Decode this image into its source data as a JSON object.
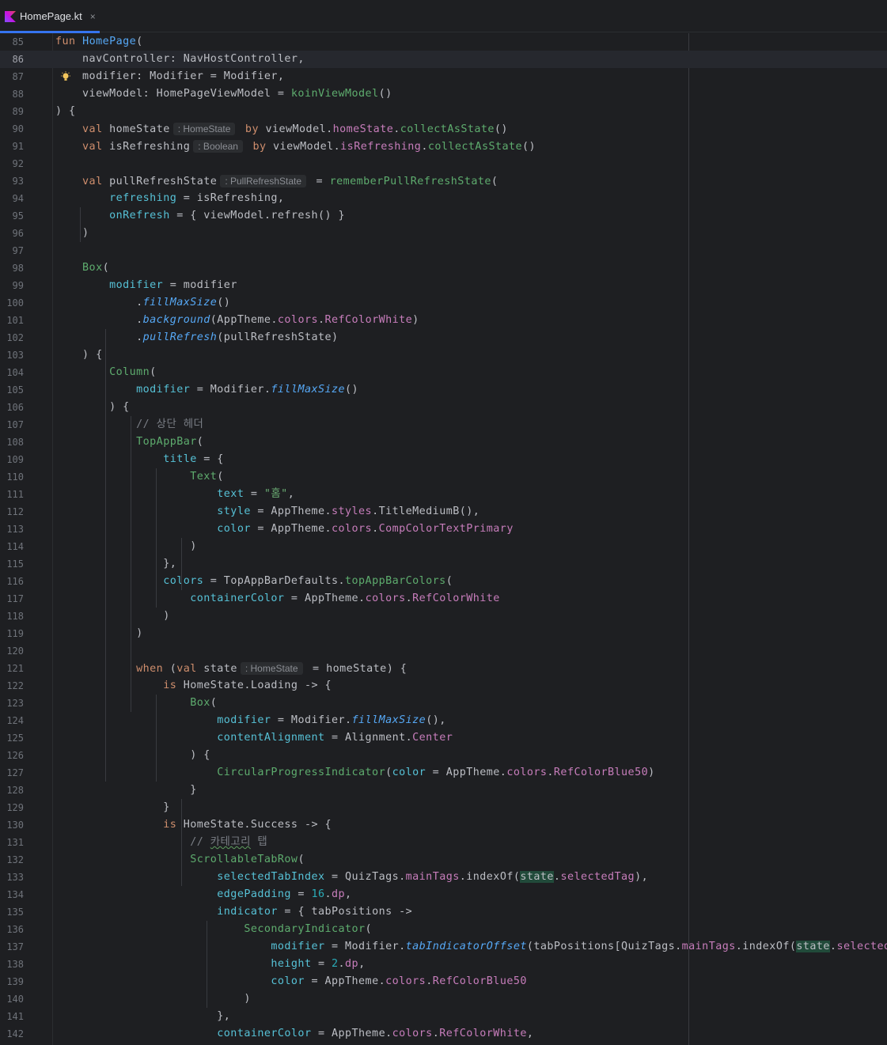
{
  "tab": {
    "filename": "HomePage.kt",
    "close": "×"
  },
  "editor": {
    "current_line": 86,
    "lines": [
      {
        "n": 85,
        "tokens": [
          [
            "kw",
            "fun "
          ],
          [
            "fn",
            "HomePage"
          ],
          [
            "",
            "("
          ]
        ]
      },
      {
        "n": 86,
        "tokens": [
          [
            "",
            "    navController: NavHostController,"
          ]
        ]
      },
      {
        "n": 87,
        "tokens": [
          [
            "",
            "    modifier: Modifier = Modifier,"
          ]
        ]
      },
      {
        "n": 88,
        "tokens": [
          [
            "",
            "    viewModel: HomePageViewModel = "
          ],
          [
            "comp",
            "koinViewModel"
          ],
          [
            "",
            "()"
          ]
        ]
      },
      {
        "n": 89,
        "tokens": [
          [
            "",
            ") {"
          ]
        ]
      },
      {
        "n": 90,
        "tokens": [
          [
            "kw",
            "    val "
          ],
          [
            "",
            "homeState"
          ],
          [
            "hint",
            ": HomeState"
          ],
          [
            "kw",
            " by "
          ],
          [
            "",
            "viewModel."
          ],
          [
            "pr",
            "homeState"
          ],
          [
            "",
            "."
          ],
          [
            "comp",
            "collectAsState"
          ],
          [
            "",
            "()"
          ]
        ]
      },
      {
        "n": 91,
        "tokens": [
          [
            "kw",
            "    val "
          ],
          [
            "",
            "isRefreshing"
          ],
          [
            "hint",
            ": Boolean"
          ],
          [
            "kw",
            " by "
          ],
          [
            "",
            "viewModel."
          ],
          [
            "pr",
            "isRefreshing"
          ],
          [
            "",
            "."
          ],
          [
            "comp",
            "collectAsState"
          ],
          [
            "",
            "()"
          ]
        ]
      },
      {
        "n": 92,
        "tokens": []
      },
      {
        "n": 93,
        "tokens": [
          [
            "kw",
            "    val "
          ],
          [
            "",
            "pullRefreshState"
          ],
          [
            "hint",
            ": PullRefreshState"
          ],
          [
            "",
            ""
          ],
          [
            "",
            " = "
          ],
          [
            "comp",
            "rememberPullRefreshState"
          ],
          [
            "",
            "("
          ]
        ]
      },
      {
        "n": 94,
        "tokens": [
          [
            "pm",
            "        refreshing"
          ],
          [
            "",
            " = isRefreshing,"
          ]
        ]
      },
      {
        "n": 95,
        "tokens": [
          [
            "pm",
            "        onRefresh"
          ],
          [
            "",
            " = { viewModel.refresh() }"
          ]
        ]
      },
      {
        "n": 96,
        "tokens": [
          [
            "",
            "    )"
          ]
        ]
      },
      {
        "n": 97,
        "tokens": []
      },
      {
        "n": 98,
        "tokens": [
          [
            "comp",
            "    Box"
          ],
          [
            "",
            "("
          ]
        ]
      },
      {
        "n": 99,
        "tokens": [
          [
            "pm",
            "        modifier"
          ],
          [
            "",
            " = modifier"
          ]
        ]
      },
      {
        "n": 100,
        "tokens": [
          [
            "",
            "            ."
          ],
          [
            "ext",
            "fillMaxSize"
          ],
          [
            "",
            "()"
          ]
        ]
      },
      {
        "n": 101,
        "tokens": [
          [
            "",
            "            ."
          ],
          [
            "ext",
            "background"
          ],
          [
            "",
            "(AppTheme."
          ],
          [
            "pr",
            "colors"
          ],
          [
            "",
            "."
          ],
          [
            "pr",
            "RefColorWhite"
          ],
          [
            "",
            ")"
          ]
        ]
      },
      {
        "n": 102,
        "tokens": [
          [
            "",
            "            ."
          ],
          [
            "ext",
            "pullRefresh"
          ],
          [
            "",
            "(pullRefreshState)"
          ]
        ]
      },
      {
        "n": 103,
        "tokens": [
          [
            "",
            "    ) {"
          ]
        ]
      },
      {
        "n": 104,
        "tokens": [
          [
            "comp",
            "        Column"
          ],
          [
            "",
            "("
          ]
        ]
      },
      {
        "n": 105,
        "tokens": [
          [
            "pm",
            "            modifier"
          ],
          [
            "",
            " = Modifier."
          ],
          [
            "ext",
            "fillMaxSize"
          ],
          [
            "",
            "()"
          ]
        ]
      },
      {
        "n": 106,
        "tokens": [
          [
            "",
            "        ) {"
          ]
        ]
      },
      {
        "n": 107,
        "tokens": [
          [
            "cm",
            "            // 상단 헤더"
          ]
        ]
      },
      {
        "n": 108,
        "tokens": [
          [
            "comp",
            "            TopAppBar"
          ],
          [
            "",
            "("
          ]
        ]
      },
      {
        "n": 109,
        "tokens": [
          [
            "pm",
            "                title"
          ],
          [
            "",
            " = {"
          ]
        ]
      },
      {
        "n": 110,
        "tokens": [
          [
            "comp",
            "                    Text"
          ],
          [
            "",
            "("
          ]
        ]
      },
      {
        "n": 111,
        "tokens": [
          [
            "pm",
            "                        text"
          ],
          [
            "",
            " = "
          ],
          [
            "str",
            "\"홈\""
          ],
          [
            "",
            ","
          ]
        ]
      },
      {
        "n": 112,
        "tokens": [
          [
            "pm",
            "                        style"
          ],
          [
            "",
            " = AppTheme."
          ],
          [
            "pr",
            "styles"
          ],
          [
            "",
            ".TitleMediumB(),"
          ]
        ]
      },
      {
        "n": 113,
        "tokens": [
          [
            "pm",
            "                        color"
          ],
          [
            "",
            " = AppTheme."
          ],
          [
            "pr",
            "colors"
          ],
          [
            "",
            "."
          ],
          [
            "pr",
            "CompColorTextPrimary"
          ]
        ]
      },
      {
        "n": 114,
        "tokens": [
          [
            "",
            "                    )"
          ]
        ]
      },
      {
        "n": 115,
        "tokens": [
          [
            "",
            "                },"
          ]
        ]
      },
      {
        "n": 116,
        "tokens": [
          [
            "pm",
            "                colors"
          ],
          [
            "",
            " = TopAppBarDefaults."
          ],
          [
            "comp",
            "topAppBarColors"
          ],
          [
            "",
            "("
          ]
        ]
      },
      {
        "n": 117,
        "tokens": [
          [
            "pm",
            "                    containerColor"
          ],
          [
            "",
            " = AppTheme."
          ],
          [
            "pr",
            "colors"
          ],
          [
            "",
            "."
          ],
          [
            "pr",
            "RefColorWhite"
          ]
        ]
      },
      {
        "n": 118,
        "tokens": [
          [
            "",
            "                )"
          ]
        ]
      },
      {
        "n": 119,
        "tokens": [
          [
            "",
            "            )"
          ]
        ]
      },
      {
        "n": 120,
        "tokens": []
      },
      {
        "n": 121,
        "tokens": [
          [
            "kw",
            "            when "
          ],
          [
            "",
            "("
          ],
          [
            "kw",
            "val "
          ],
          [
            "",
            "state"
          ],
          [
            "hint",
            ": HomeState"
          ],
          [
            "",
            " = homeState) {"
          ]
        ]
      },
      {
        "n": 122,
        "tokens": [
          [
            "kw",
            "                is "
          ],
          [
            "",
            "HomeState.Loading -> {"
          ]
        ]
      },
      {
        "n": 123,
        "tokens": [
          [
            "comp",
            "                    Box"
          ],
          [
            "",
            "("
          ]
        ]
      },
      {
        "n": 124,
        "tokens": [
          [
            "pm",
            "                        modifier"
          ],
          [
            "",
            " = Modifier."
          ],
          [
            "ext",
            "fillMaxSize"
          ],
          [
            "",
            "(),"
          ]
        ]
      },
      {
        "n": 125,
        "tokens": [
          [
            "pm",
            "                        contentAlignment"
          ],
          [
            "",
            " = Alignment."
          ],
          [
            "pr",
            "Center"
          ]
        ]
      },
      {
        "n": 126,
        "tokens": [
          [
            "",
            "                    ) {"
          ]
        ]
      },
      {
        "n": 127,
        "tokens": [
          [
            "comp",
            "                        CircularProgressIndicator"
          ],
          [
            "",
            "("
          ],
          [
            "pm",
            "color"
          ],
          [
            "",
            " = AppTheme."
          ],
          [
            "pr",
            "colors"
          ],
          [
            "",
            "."
          ],
          [
            "pr",
            "RefColorBlue50"
          ],
          [
            "",
            ")"
          ]
        ]
      },
      {
        "n": 128,
        "tokens": [
          [
            "",
            "                    }"
          ]
        ]
      },
      {
        "n": 129,
        "tokens": [
          [
            "",
            "                }"
          ]
        ]
      },
      {
        "n": 130,
        "tokens": [
          [
            "kw",
            "                is "
          ],
          [
            "",
            "HomeState.Success -> {"
          ]
        ]
      },
      {
        "n": 131,
        "tokens": [
          [
            "cm",
            "                    // "
          ],
          [
            "cm typo",
            "카테고리"
          ],
          [
            "cm",
            " 탭"
          ]
        ]
      },
      {
        "n": 132,
        "tokens": [
          [
            "comp",
            "                    ScrollableTabRow"
          ],
          [
            "",
            "("
          ]
        ]
      },
      {
        "n": 133,
        "tokens": [
          [
            "pm",
            "                        selectedTabIndex"
          ],
          [
            "",
            " = QuizTags."
          ],
          [
            "pr",
            "mainTags"
          ],
          [
            "",
            ".indexOf("
          ],
          [
            "hl",
            "state"
          ],
          [
            "",
            "."
          ],
          [
            "pr",
            "selectedTag"
          ],
          [
            "",
            "),"
          ]
        ]
      },
      {
        "n": 134,
        "tokens": [
          [
            "pm",
            "                        edgePadding"
          ],
          [
            "",
            " = "
          ],
          [
            "num",
            "16"
          ],
          [
            "",
            "."
          ],
          [
            "pr",
            "dp"
          ],
          [
            "",
            ","
          ]
        ]
      },
      {
        "n": 135,
        "tokens": [
          [
            "pm",
            "                        indicator"
          ],
          [
            "",
            " = { tabPositions ->"
          ]
        ]
      },
      {
        "n": 136,
        "tokens": [
          [
            "comp",
            "                            SecondaryIndicator"
          ],
          [
            "",
            "("
          ]
        ]
      },
      {
        "n": 137,
        "tokens": [
          [
            "pm",
            "                                modifier"
          ],
          [
            "",
            " = Modifier."
          ],
          [
            "ext",
            "tabIndicatorOffset"
          ],
          [
            "",
            "(tabPositions[QuizTags."
          ],
          [
            "pr",
            "mainTags"
          ],
          [
            "",
            ".indexOf("
          ],
          [
            "hl",
            "state"
          ],
          [
            "",
            "."
          ],
          [
            "pr",
            "selectedTag"
          ],
          [
            "",
            ")]),"
          ]
        ]
      },
      {
        "n": 138,
        "tokens": [
          [
            "pm",
            "                                height"
          ],
          [
            "",
            " = "
          ],
          [
            "num",
            "2"
          ],
          [
            "",
            "."
          ],
          [
            "pr",
            "dp"
          ],
          [
            "",
            ","
          ]
        ]
      },
      {
        "n": 139,
        "tokens": [
          [
            "pm",
            "                                color"
          ],
          [
            "",
            " = AppTheme."
          ],
          [
            "pr",
            "colors"
          ],
          [
            "",
            "."
          ],
          [
            "pr",
            "RefColorBlue50"
          ]
        ]
      },
      {
        "n": 140,
        "tokens": [
          [
            "",
            "                            )"
          ]
        ]
      },
      {
        "n": 141,
        "tokens": [
          [
            "",
            "                        },"
          ]
        ]
      },
      {
        "n": 142,
        "tokens": [
          [
            "pm",
            "                        containerColor"
          ],
          [
            "",
            " = AppTheme."
          ],
          [
            "pr",
            "colors"
          ],
          [
            "",
            "."
          ],
          [
            "pr",
            "RefColorWhite"
          ],
          [
            "",
            ","
          ]
        ]
      }
    ]
  }
}
